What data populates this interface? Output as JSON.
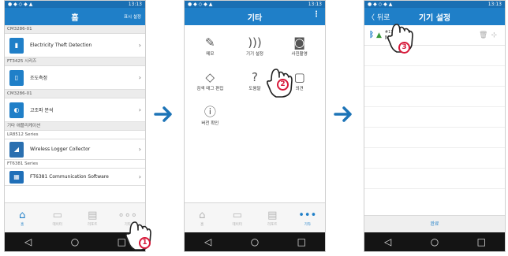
{
  "status_time": "13:13",
  "phone1": {
    "title": "홈",
    "header_right": "표시 설정",
    "sections": [
      {
        "header": "CM3286-01",
        "item": "Electricity Theft Detection",
        "icon": "sensor-icon"
      },
      {
        "header": "FT3425 시리즈",
        "item": "조도측정",
        "icon": "lux-meter-icon"
      },
      {
        "header": "CM3286-01",
        "item": "고조파 분석",
        "icon": "clamp-icon"
      },
      {
        "header": "기타 애플리케이션",
        "item": "",
        "icon": ""
      },
      {
        "header": "LR8512 Series",
        "item": "Wireless Logger Collector",
        "icon": "satellite-icon"
      },
      {
        "header": "FT6381 Series",
        "item": "FT6381 Communication Software",
        "icon": "app-icon"
      }
    ],
    "tabs": [
      "홈",
      "데이터",
      "리포트",
      "기타"
    ],
    "step": "1"
  },
  "phone2": {
    "title": "기타",
    "grid": [
      {
        "label": "메모",
        "icon": "pencil-icon"
      },
      {
        "label": "기기 설정",
        "icon": "wireless-icon"
      },
      {
        "label": "사진촬영",
        "icon": "camera-icon"
      },
      {
        "label": "검색 태그 편집",
        "icon": "tag-icon"
      },
      {
        "label": "도움말",
        "icon": "help-icon"
      },
      {
        "label": "의견",
        "icon": "chat-icon"
      },
      {
        "label": "버전 확인",
        "icon": "info-icon"
      }
    ],
    "tabs": [
      "홈",
      "데이터",
      "리포트",
      "기타"
    ],
    "step": "2"
  },
  "phone3": {
    "title": "기기 설정",
    "back_label": "〈 뒤로",
    "device_serial": "#170699593",
    "device_name": "METER",
    "confirm_label": "완료",
    "step": "3"
  },
  "colors": {
    "accent": "#1f7fc8",
    "arrow": "#1d74b7",
    "step_badge": "#d7193a"
  }
}
